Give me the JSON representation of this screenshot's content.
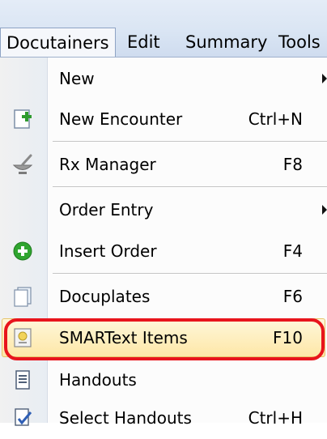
{
  "menubar": {
    "items": [
      {
        "label": "Docutainers",
        "active": true
      },
      {
        "label": "Edit"
      },
      {
        "label": "Summary"
      },
      {
        "label": "Tools"
      }
    ]
  },
  "menu": {
    "items": [
      {
        "label": "New",
        "shortcut": "",
        "icon": null,
        "submenu": true
      },
      {
        "label": "New Encounter",
        "shortcut": "Ctrl+N",
        "icon": "new-encounter-icon"
      },
      {
        "label": "Rx Manager",
        "shortcut": "F8",
        "icon": "mortar-pestle-icon"
      },
      {
        "label": "Order Entry",
        "shortcut": "",
        "icon": null,
        "submenu": true
      },
      {
        "label": "Insert Order",
        "shortcut": "F4",
        "icon": "green-plus-icon"
      },
      {
        "label": "Docuplates",
        "shortcut": "F6",
        "icon": "docuplates-icon"
      },
      {
        "label": "SMARText Items",
        "shortcut": "F10",
        "icon": "smartext-icon",
        "highlighted": true
      },
      {
        "label": "Handouts",
        "shortcut": "",
        "icon": "handouts-icon"
      },
      {
        "label": "Select Handouts",
        "shortcut": "Ctrl+H",
        "icon": "select-handouts-icon"
      }
    ]
  },
  "colors": {
    "highlight_ring": "#e8141c",
    "highlight_fill": "#fde7a7",
    "menubar_bg": "#dbe6f4"
  }
}
